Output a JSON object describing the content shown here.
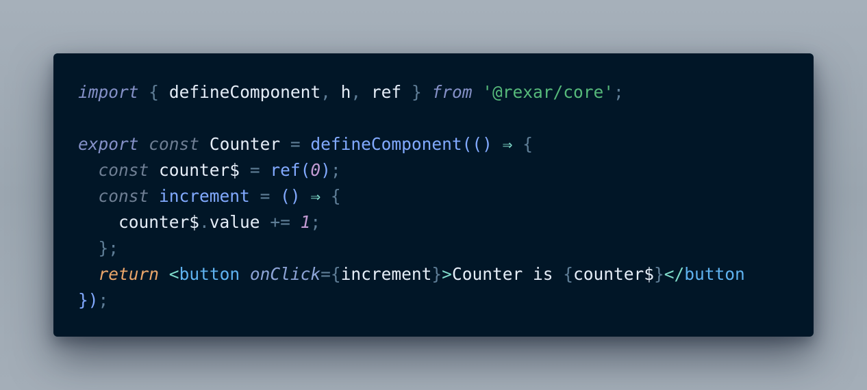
{
  "editor": {
    "lines": [
      [
        {
          "t": "import",
          "c": "kw-import italic"
        },
        {
          "t": " ",
          "c": ""
        },
        {
          "t": "{",
          "c": "punct"
        },
        {
          "t": " ",
          "c": ""
        },
        {
          "t": "defineComponent",
          "c": "ident"
        },
        {
          "t": ",",
          "c": "punct"
        },
        {
          "t": " ",
          "c": ""
        },
        {
          "t": "h",
          "c": "ident"
        },
        {
          "t": ",",
          "c": "punct"
        },
        {
          "t": " ",
          "c": ""
        },
        {
          "t": "ref",
          "c": "ident"
        },
        {
          "t": " ",
          "c": ""
        },
        {
          "t": "}",
          "c": "punct"
        },
        {
          "t": " ",
          "c": ""
        },
        {
          "t": "from",
          "c": "kw-import italic"
        },
        {
          "t": " ",
          "c": ""
        },
        {
          "t": "'@rexar/core'",
          "c": "str"
        },
        {
          "t": ";",
          "c": "punct"
        }
      ],
      [],
      [
        {
          "t": "export",
          "c": "kw-import italic"
        },
        {
          "t": " ",
          "c": ""
        },
        {
          "t": "const",
          "c": "kw-const italic"
        },
        {
          "t": " ",
          "c": ""
        },
        {
          "t": "Counter",
          "c": "ident"
        },
        {
          "t": " ",
          "c": ""
        },
        {
          "t": "=",
          "c": "punct"
        },
        {
          "t": " ",
          "c": ""
        },
        {
          "t": "defineComponent",
          "c": "fn"
        },
        {
          "t": "(() ",
          "c": "fn"
        },
        {
          "t": "⇒",
          "c": "arrow"
        },
        {
          "t": " ",
          "c": ""
        },
        {
          "t": "{",
          "c": "punct"
        }
      ],
      [
        {
          "t": "  ",
          "c": ""
        },
        {
          "t": "const",
          "c": "kw-const italic"
        },
        {
          "t": " ",
          "c": ""
        },
        {
          "t": "counter$",
          "c": "ident"
        },
        {
          "t": " ",
          "c": ""
        },
        {
          "t": "=",
          "c": "punct"
        },
        {
          "t": " ",
          "c": ""
        },
        {
          "t": "ref(",
          "c": "fn"
        },
        {
          "t": "0",
          "c": "num italic"
        },
        {
          "t": ")",
          "c": "fn"
        },
        {
          "t": ";",
          "c": "punct"
        }
      ],
      [
        {
          "t": "  ",
          "c": ""
        },
        {
          "t": "const",
          "c": "kw-const italic"
        },
        {
          "t": " ",
          "c": ""
        },
        {
          "t": "increment",
          "c": "fn"
        },
        {
          "t": " ",
          "c": ""
        },
        {
          "t": "=",
          "c": "punct"
        },
        {
          "t": " ",
          "c": ""
        },
        {
          "t": "()",
          "c": "fn"
        },
        {
          "t": " ",
          "c": ""
        },
        {
          "t": "⇒",
          "c": "arrow"
        },
        {
          "t": " ",
          "c": ""
        },
        {
          "t": "{",
          "c": "punct"
        }
      ],
      [
        {
          "t": "    ",
          "c": ""
        },
        {
          "t": "counter$",
          "c": "ident"
        },
        {
          "t": ".",
          "c": "punct"
        },
        {
          "t": "value",
          "c": "ident"
        },
        {
          "t": " ",
          "c": ""
        },
        {
          "t": "+=",
          "c": "punct"
        },
        {
          "t": " ",
          "c": ""
        },
        {
          "t": "1",
          "c": "num italic"
        },
        {
          "t": ";",
          "c": "punct"
        }
      ],
      [
        {
          "t": "  ",
          "c": ""
        },
        {
          "t": "};",
          "c": "punct"
        }
      ],
      [
        {
          "t": "  ",
          "c": ""
        },
        {
          "t": "return",
          "c": "kw-return italic"
        },
        {
          "t": " ",
          "c": ""
        },
        {
          "t": "<",
          "c": "tag"
        },
        {
          "t": "button",
          "c": "tag-name"
        },
        {
          "t": " ",
          "c": ""
        },
        {
          "t": "onClick",
          "c": "attr italic"
        },
        {
          "t": "=",
          "c": "punct"
        },
        {
          "t": "{",
          "c": "punct"
        },
        {
          "t": "increment",
          "c": "ident"
        },
        {
          "t": "}",
          "c": "punct"
        },
        {
          "t": ">",
          "c": "tag"
        },
        {
          "t": "Counter is ",
          "c": "ident"
        },
        {
          "t": "{",
          "c": "punct"
        },
        {
          "t": "counter$",
          "c": "ident"
        },
        {
          "t": "}",
          "c": "punct"
        },
        {
          "t": "</",
          "c": "tag"
        },
        {
          "t": "button",
          "c": "tag-name"
        }
      ],
      [
        {
          "t": "})",
          "c": "fn"
        },
        {
          "t": ";",
          "c": "punct"
        }
      ]
    ]
  }
}
